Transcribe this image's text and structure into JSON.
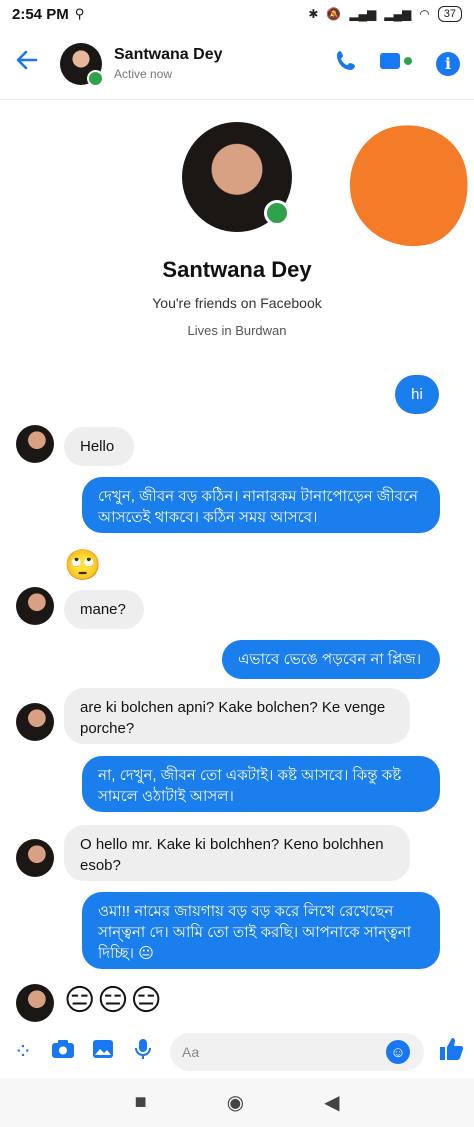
{
  "status": {
    "time": "2:54 PM",
    "battery": "37"
  },
  "header": {
    "name": "Santwana Dey",
    "status": "Active now"
  },
  "profile": {
    "name": "Santwana Dey",
    "friends_text": "You're friends on Facebook",
    "location_text": "Lives in Burdwan"
  },
  "messages": [
    {
      "from": "me",
      "text": "hi"
    },
    {
      "from": "them",
      "text": "Hello"
    },
    {
      "from": "me",
      "text": "দেখুন, জীবন বড় কঠিন। নানারকম টানাপোড়েন জীবনে আসতেই থাকবে। কঠিন সময় আসবে।"
    },
    {
      "from": "them",
      "text": "🙄"
    },
    {
      "from": "them",
      "text": "mane?"
    },
    {
      "from": "me",
      "text": "এভাবে ভেঙে পড়বেন না প্লিজ।"
    },
    {
      "from": "them",
      "text": "are ki bolchen apni? Kake bolchen? Ke venge porche?"
    },
    {
      "from": "me",
      "text": "না, দেখুন, জীবন তো একটাই। কষ্ট আসবে। কিন্তু কষ্ট সামলে ওঠাটাই আসল।"
    },
    {
      "from": "them",
      "text": "O hello mr. Kake ki bolchhen? Keno bolchhen esob?"
    },
    {
      "from": "me",
      "text": "ওমা!! নামের জায়গায় বড় বড় করে লিখে রেখেছেন সান্ত্বনা দে। আমি তো তাই করছি। আপনাকে সান্ত্বনা দিচ্ছি। 😐"
    },
    {
      "from": "them",
      "text": "😑😑😑"
    }
  ],
  "composer": {
    "placeholder": "Aa"
  },
  "colors": {
    "accent": "#1877f2",
    "outgoing_bubble": "#1a7eec",
    "incoming_bubble": "#eeeeee",
    "online": "#31a24c"
  }
}
